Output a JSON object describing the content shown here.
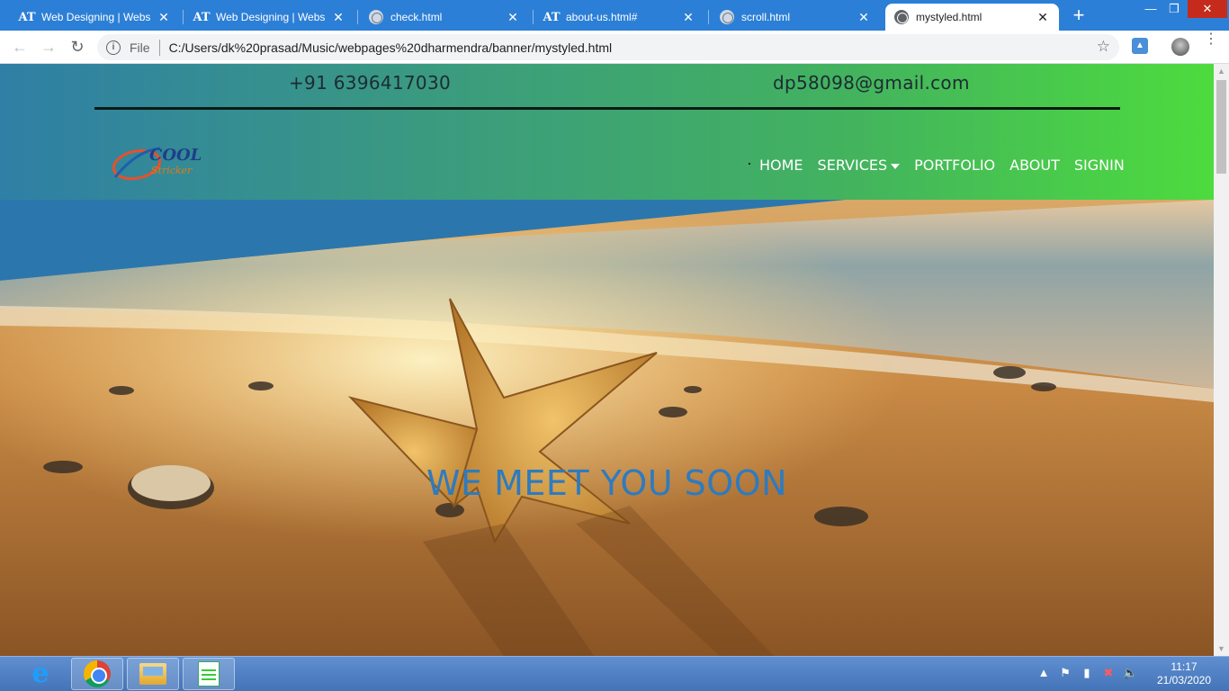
{
  "browser": {
    "tabs": [
      {
        "title": "Web Designing | Website",
        "icon": "AT",
        "close": "✕"
      },
      {
        "title": "Web Designing | Website",
        "icon": "AT",
        "close": "✕"
      },
      {
        "title": "check.html",
        "icon": "globe",
        "close": "✕"
      },
      {
        "title": "about-us.html#",
        "icon": "AT",
        "close": "✕"
      },
      {
        "title": "scroll.html",
        "icon": "globe",
        "close": "✕"
      },
      {
        "title": "mystyled.html",
        "icon": "globe",
        "close": "✕",
        "active": true
      }
    ],
    "new_tab": "+",
    "window_controls": {
      "minimize": "—",
      "restore": "❐",
      "close": "✕"
    },
    "nav": {
      "back": "←",
      "forward": "→",
      "reload": "↻"
    },
    "omnibox": {
      "info": "i",
      "scheme_label": "File",
      "url": "C:/Users/dk%20prasad/Music/webpages%20dharmendra/banner/mystyled.html"
    },
    "bookmark_star": "☆",
    "menu": "⋮"
  },
  "page": {
    "header": {
      "phone": "+91 6396417030",
      "email": "dp58098@gmail.com",
      "logo_text_main": "COOL",
      "logo_text_sub": "Stricker"
    },
    "nav": [
      {
        "label": "HOME"
      },
      {
        "label": "SERVICES",
        "has_dropdown": true
      },
      {
        "label": "PORTFOLIO"
      },
      {
        "label": "ABOUT"
      },
      {
        "label": "SIGNIN"
      }
    ],
    "banner": {
      "headline": "WE MEET YOU SOON"
    },
    "colors": {
      "header_gradient": [
        "#2f7fa6",
        "#3a9a80",
        "#43b35e",
        "#4ddb3e"
      ],
      "banner_sky": "#2b77ad",
      "headline": "#2e7bbf"
    }
  },
  "taskbar": {
    "clock_time": "11:17",
    "clock_date": "21/03/2020",
    "apps": [
      "internet-explorer",
      "chrome",
      "file-explorer",
      "notepad"
    ],
    "tray": {
      "expand": "▲",
      "flag": "⚑",
      "power": "▮",
      "network": "✖",
      "volume": "🔈"
    }
  }
}
